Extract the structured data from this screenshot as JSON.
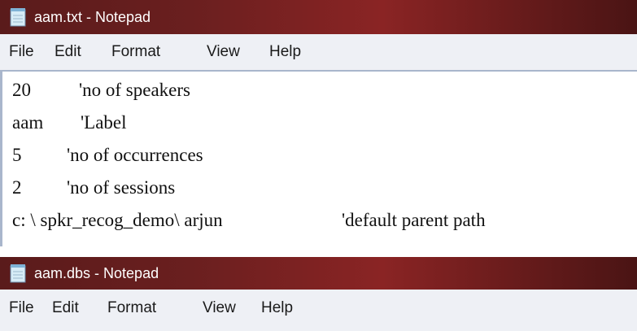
{
  "windows": [
    {
      "title": "aam.txt - Notepad",
      "menu": [
        "File",
        "Edit",
        "Format",
        "View",
        "Help"
      ],
      "lines": [
        {
          "value": "20",
          "comment": "'no of speakers"
        },
        {
          "value": "aam",
          "comment": "'Label"
        },
        {
          "value": "5",
          "comment": "'no of occurrences"
        },
        {
          "value": "2",
          "comment": "'no of sessions"
        },
        {
          "value": "c: \\ spkr_recog_demo\\ arjun",
          "comment": "'default parent path"
        }
      ]
    },
    {
      "title": "aam.dbs - Notepad",
      "menu": [
        "File",
        "Edit",
        "Format",
        "View",
        "Help"
      ]
    }
  ],
  "icons": {
    "app_icon": "notepad-icon"
  },
  "colors": {
    "titlebar": "#6a1f1f",
    "menubar": "#eef0f5",
    "title_text": "#ffffff",
    "editor_border": "#a9b6cc"
  }
}
